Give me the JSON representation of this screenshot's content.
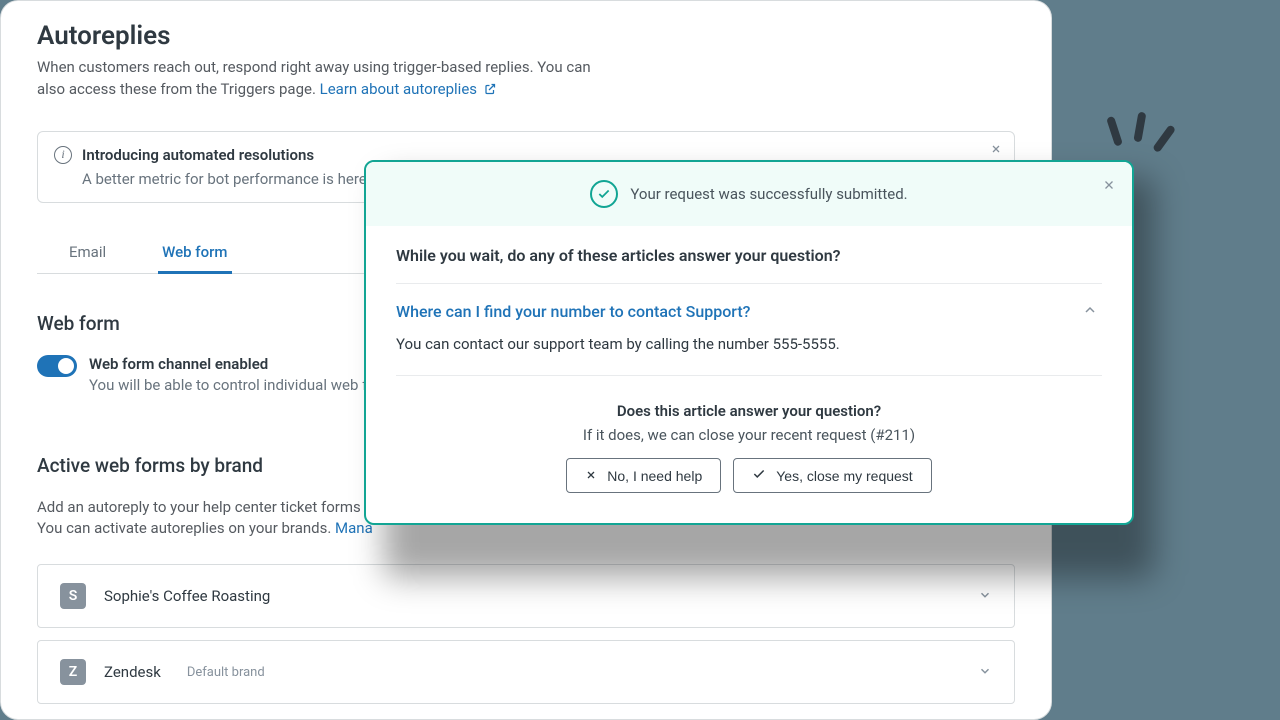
{
  "page": {
    "title": "Autoreplies",
    "description_a": "When customers reach out, respond right away using trigger-based replies. You can also access these from the Triggers page. ",
    "description_link": "Learn about autoreplies"
  },
  "notice": {
    "title": "Introducing automated resolutions",
    "body": "A better metric for bot performance is here."
  },
  "tabs": [
    {
      "label": "Email"
    },
    {
      "label": "Web form"
    }
  ],
  "webform": {
    "section_title": "Web form",
    "toggle_label": "Web form channel enabled",
    "toggle_sub": "You will be able to control individual web fo"
  },
  "brands": {
    "section_title": "Active web forms by brand",
    "description_a": "Add an autoreply to your help center ticket forms t",
    "description_b": "You can activate autoreplies on your brands. ",
    "manage_link": "Mana",
    "items": [
      {
        "initial": "S",
        "name": "Sophie's Coffee Roasting",
        "default": null
      },
      {
        "initial": "Z",
        "name": "Zendesk",
        "default": "Default brand"
      }
    ]
  },
  "modal": {
    "success": "Your request was successfully submitted.",
    "heading": "While you wait, do any of these articles answer your question?",
    "article_title": "Where can I find your number to contact Support?",
    "article_body": "You can contact our support team by calling the number 555-5555.",
    "prompt_title": "Does this article answer your question?",
    "prompt_sub": "If it does, we can close your recent request (#211)",
    "no_btn": "No, I need help",
    "yes_btn": "Yes, close my request"
  }
}
